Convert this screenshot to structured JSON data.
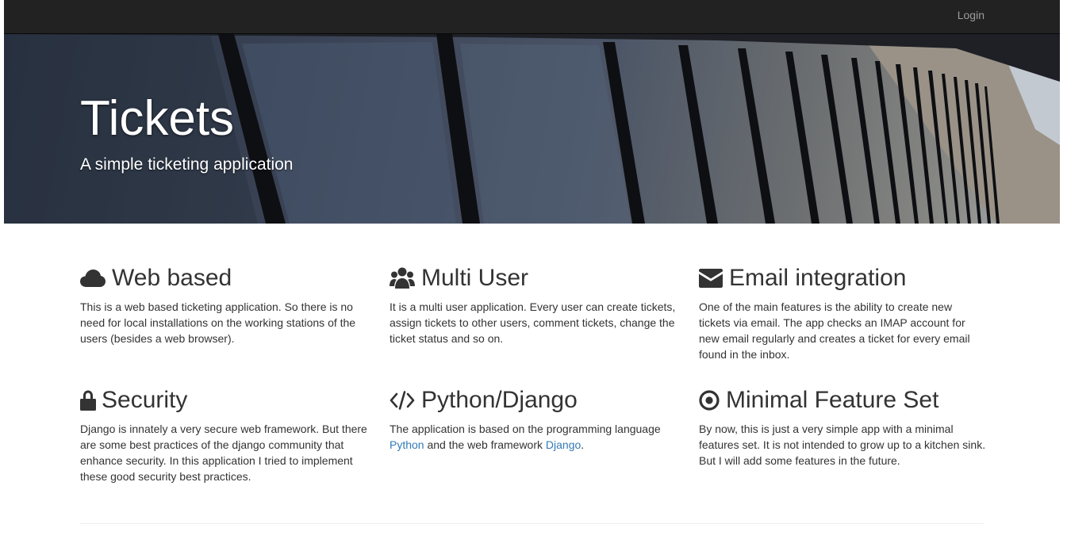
{
  "navbar": {
    "login_label": "Login"
  },
  "hero": {
    "title": "Tickets",
    "subtitle": "A simple ticketing application"
  },
  "features": [
    {
      "icon": "cloud-icon",
      "title": "Web based",
      "text": "This is a web based ticketing application. So there is no need for local installations on the working stations of the users (besides a web browser)."
    },
    {
      "icon": "users-icon",
      "title": "Multi User",
      "text": "It is a multi user application. Every user can create tickets, assign tickets to other users, comment tickets, change the ticket status and so on."
    },
    {
      "icon": "envelope-icon",
      "title": "Email integration",
      "text": "One of the main features is the ability to create new tickets via email. The app checks an IMAP account for new email regularly and creates a ticket for every email found in the inbox."
    },
    {
      "icon": "lock-icon",
      "title": "Security",
      "text": "Django is innately a very secure web framework. But there are some best practices of the django community that enhance security. In this application I tried to implement these good security best practices."
    },
    {
      "icon": "code-icon",
      "title": "Python/Django",
      "text_before": "The application is based on the programming language",
      "link1": "Python",
      "text_middle": "and the web framework",
      "link2": "Django",
      "text_after": "."
    },
    {
      "icon": "target-icon",
      "title": "Minimal Feature Set",
      "text": "By now, this is just a very simple app with a minimal features set. It is not intended to grow up to a kitchen sink. But I will add some features in the future."
    }
  ]
}
